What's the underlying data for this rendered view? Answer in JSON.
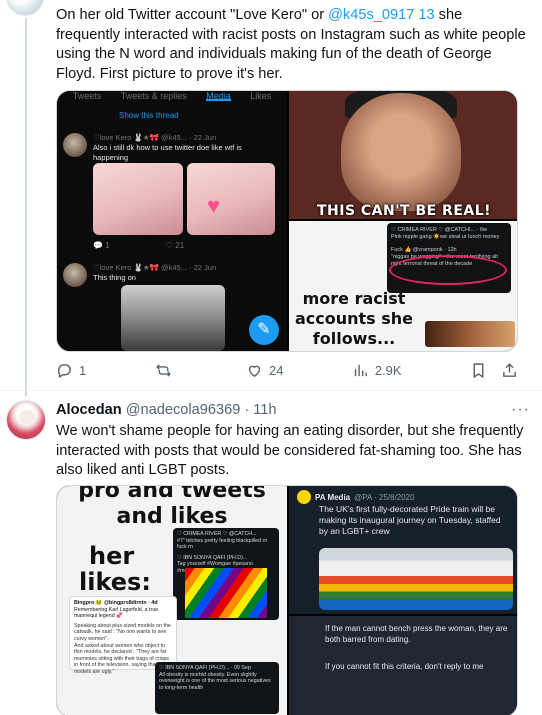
{
  "tweet1": {
    "text_before": "On her old Twitter account \"Love Kero\" or ",
    "mention": "@k45s_0917 13",
    "text_after": " she frequently interacted with racist posts on Instagram such as white people using the N word and individuals making fun of the death of  George Floyd. First picture to prove it's her.",
    "media": {
      "timeline": {
        "tabs": [
          "Tweets",
          "Tweets & replies",
          "Media",
          "Likes"
        ],
        "active_tab": "Media",
        "show_thread": "Show this thread",
        "post1_user": "♡love Kero 🐰★🎀 @k45... · 22 Jun",
        "post1_text": "Also i still dk how to use twitter doe like wtf is happening",
        "post1_replies": "1",
        "post1_likes": "21",
        "post2_user": "♡love Kero 🐰★🎀 @k45... · 22 Jun",
        "post2_text": "This thing on"
      },
      "meme_caption": "THIS CAN'T BE REAL!",
      "accounts_caption": "more racist accounts she follows...",
      "screenshot_lines": [
        "♡ CRIMEA RIVER ♡ @CATCHI... · 6w",
        "Pink nipple gang ☀️we steal ur lunch money",
        "Fuck 👍 @cramponk · 12h",
        "\"niggas be wagging\" – the most terrifying alt right terrorist threat of the decade"
      ]
    },
    "actions": {
      "replies": "1",
      "retweets": "",
      "likes": "24",
      "views": "2.9K"
    }
  },
  "tweet2": {
    "name": "Alocedan",
    "handle": "@nadecola96369",
    "dot": "·",
    "time": "11h",
    "text": "We won't shame people for having an eating disorder, but she frequently interacted with posts that would be considered fat-shaming too. She has also liked anti LGBT posts.",
    "media": {
      "likes_top": "pro and tweets and likes",
      "her": "her",
      "likes_word": "likes:",
      "ss_a": [
        "♡ CRIMEA RIVER ♡ @CATCH...",
        "#7\" bitches pretty feeling blackpilled rn fuck rn",
        "♡ IBN SONYA QAFI (PH.D)...",
        "Tag yourself #Womgae #pesano #mountinge #Alphabet"
      ],
      "ss_b": [
        "Bingpro 🐸 @bingpro8dirntn · 4d",
        "Remembering Karl Lagerfeld, a true mannequi legend 💞",
        "Speaking about plus-sized models on the catwalk, he said : \"No one wants to see curvy women\".",
        "And asked about women who object to thin models, he declared : \"They are fat mummies sitting with their bags of crisps in front of the television, saying that thin models are ugly.\""
      ],
      "ss_c": [
        "♡ IBN SONYA QAFI (PH.D)... · 09 Sep",
        "All obesity is morbid obesity. Even slightly overweight is one of the most serious negatives to long-term health"
      ],
      "pa_name": "PA Media",
      "pa_meta": "@PA · 25/8/2020",
      "pa_text": "The UK's first fully-decorated Pride train will be making its inaugural journey on Tuesday, staffed by an LGBT+ crew",
      "quote1": "If the man cannot bench press the woman, they are both barred from dating.",
      "quote2": "If you cannot fit this criteria, don't reply to me"
    }
  },
  "colors": {
    "accent": "#1d9bf0",
    "text": "#0f1419",
    "secondary": "#536471"
  },
  "icons": [
    "reply-icon",
    "retweet-icon",
    "like-icon",
    "views-icon",
    "bookmark-icon",
    "share-icon",
    "more-icon"
  ]
}
